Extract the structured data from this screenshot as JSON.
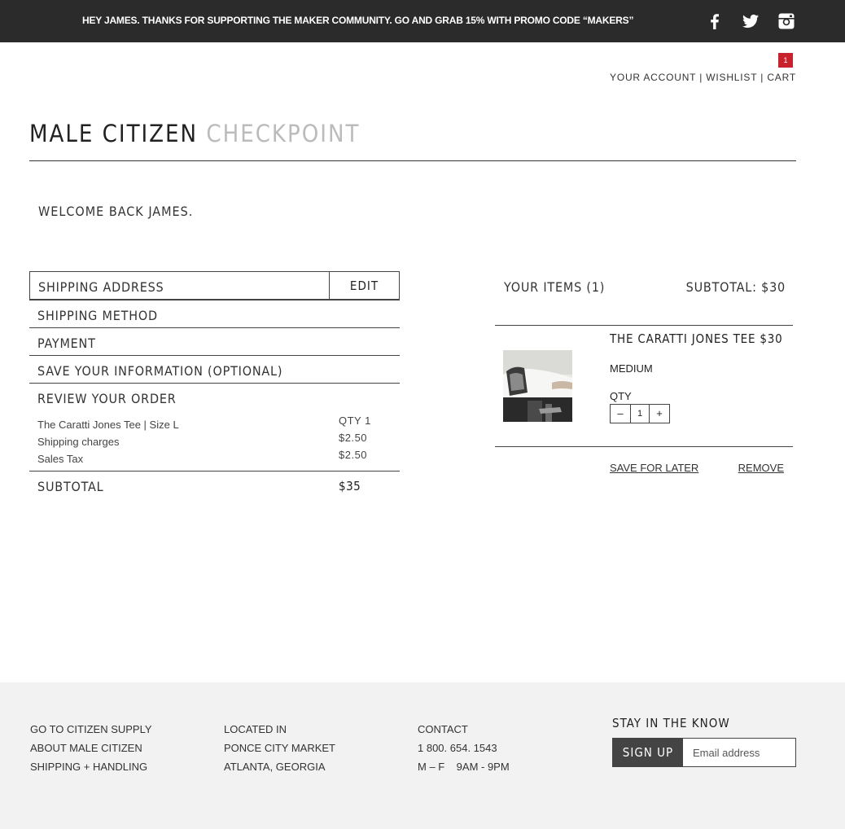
{
  "topbar": {
    "promo": "HEY JAMES. THANKS FOR SUPPORTING THE MAKER COMMUNITY.  GO AND GRAB 15% WITH PROMO CODE “MAKERS”",
    "social_icons": [
      "facebook-icon",
      "twitter-icon",
      "instagram-icon"
    ]
  },
  "header": {
    "cart_count": "1",
    "account": "YOUR ACCOUNT",
    "wishlist": "WISHLIST",
    "cart": "CART",
    "separator": "|",
    "brand_primary": "MALE CITIZEN",
    "brand_secondary": "CHECKPOINT"
  },
  "welcome": "WELCOME BACK JAMES.",
  "checkout": {
    "shipping_address": "SHIPPING ADDRESS",
    "edit": "EDIT",
    "shipping_method": "SHIPPING METHOD",
    "payment": "PAYMENT",
    "save_info": "SAVE YOUR INFORMATION (OPTIONAL)",
    "review": {
      "title": "REVIEW YOUR ORDER",
      "lines": [
        {
          "label": "The Caratti Jones Tee | Size L",
          "value": "QTY 1"
        },
        {
          "label": "Shipping charges",
          "value": "$2.50"
        },
        {
          "label": "Sales Tax",
          "value": "$2.50"
        }
      ]
    },
    "subtotal_label": "SUBTOTAL",
    "subtotal_value": "$35"
  },
  "cart_panel": {
    "items_label": "YOUR ITEMS (1)",
    "subtotal": "SUBTOTAL: $30",
    "product": {
      "name": "THE CARATTI JONES TEE $30",
      "size": "MEDIUM",
      "qty_label": "QTY",
      "qty_minus": "–",
      "qty_value": "1",
      "qty_plus": "+"
    },
    "save_for_later": "SAVE FOR LATER",
    "remove": "REMOVE"
  },
  "footer": {
    "links": [
      "GO TO CITIZEN SUPPLY",
      "ABOUT MALE CITIZEN",
      "SHIPPING + HANDLING"
    ],
    "location": [
      "LOCATED IN",
      "PONCE CITY MARKET",
      "ATLANTA, GEORGIA"
    ],
    "contact": [
      "CONTACT",
      "1 800. 654. 1543",
      "M – F    9AM - 9PM"
    ],
    "stay_title": "STAY IN THE KNOW",
    "signup_button": "SIGN UP",
    "email_placeholder": "Email address"
  },
  "colors": {
    "topbar": "#2b2b2b",
    "badge": "#c8232c",
    "brand_secondary": "#bbbbbb",
    "footer_bg": "#f2f2f2"
  }
}
